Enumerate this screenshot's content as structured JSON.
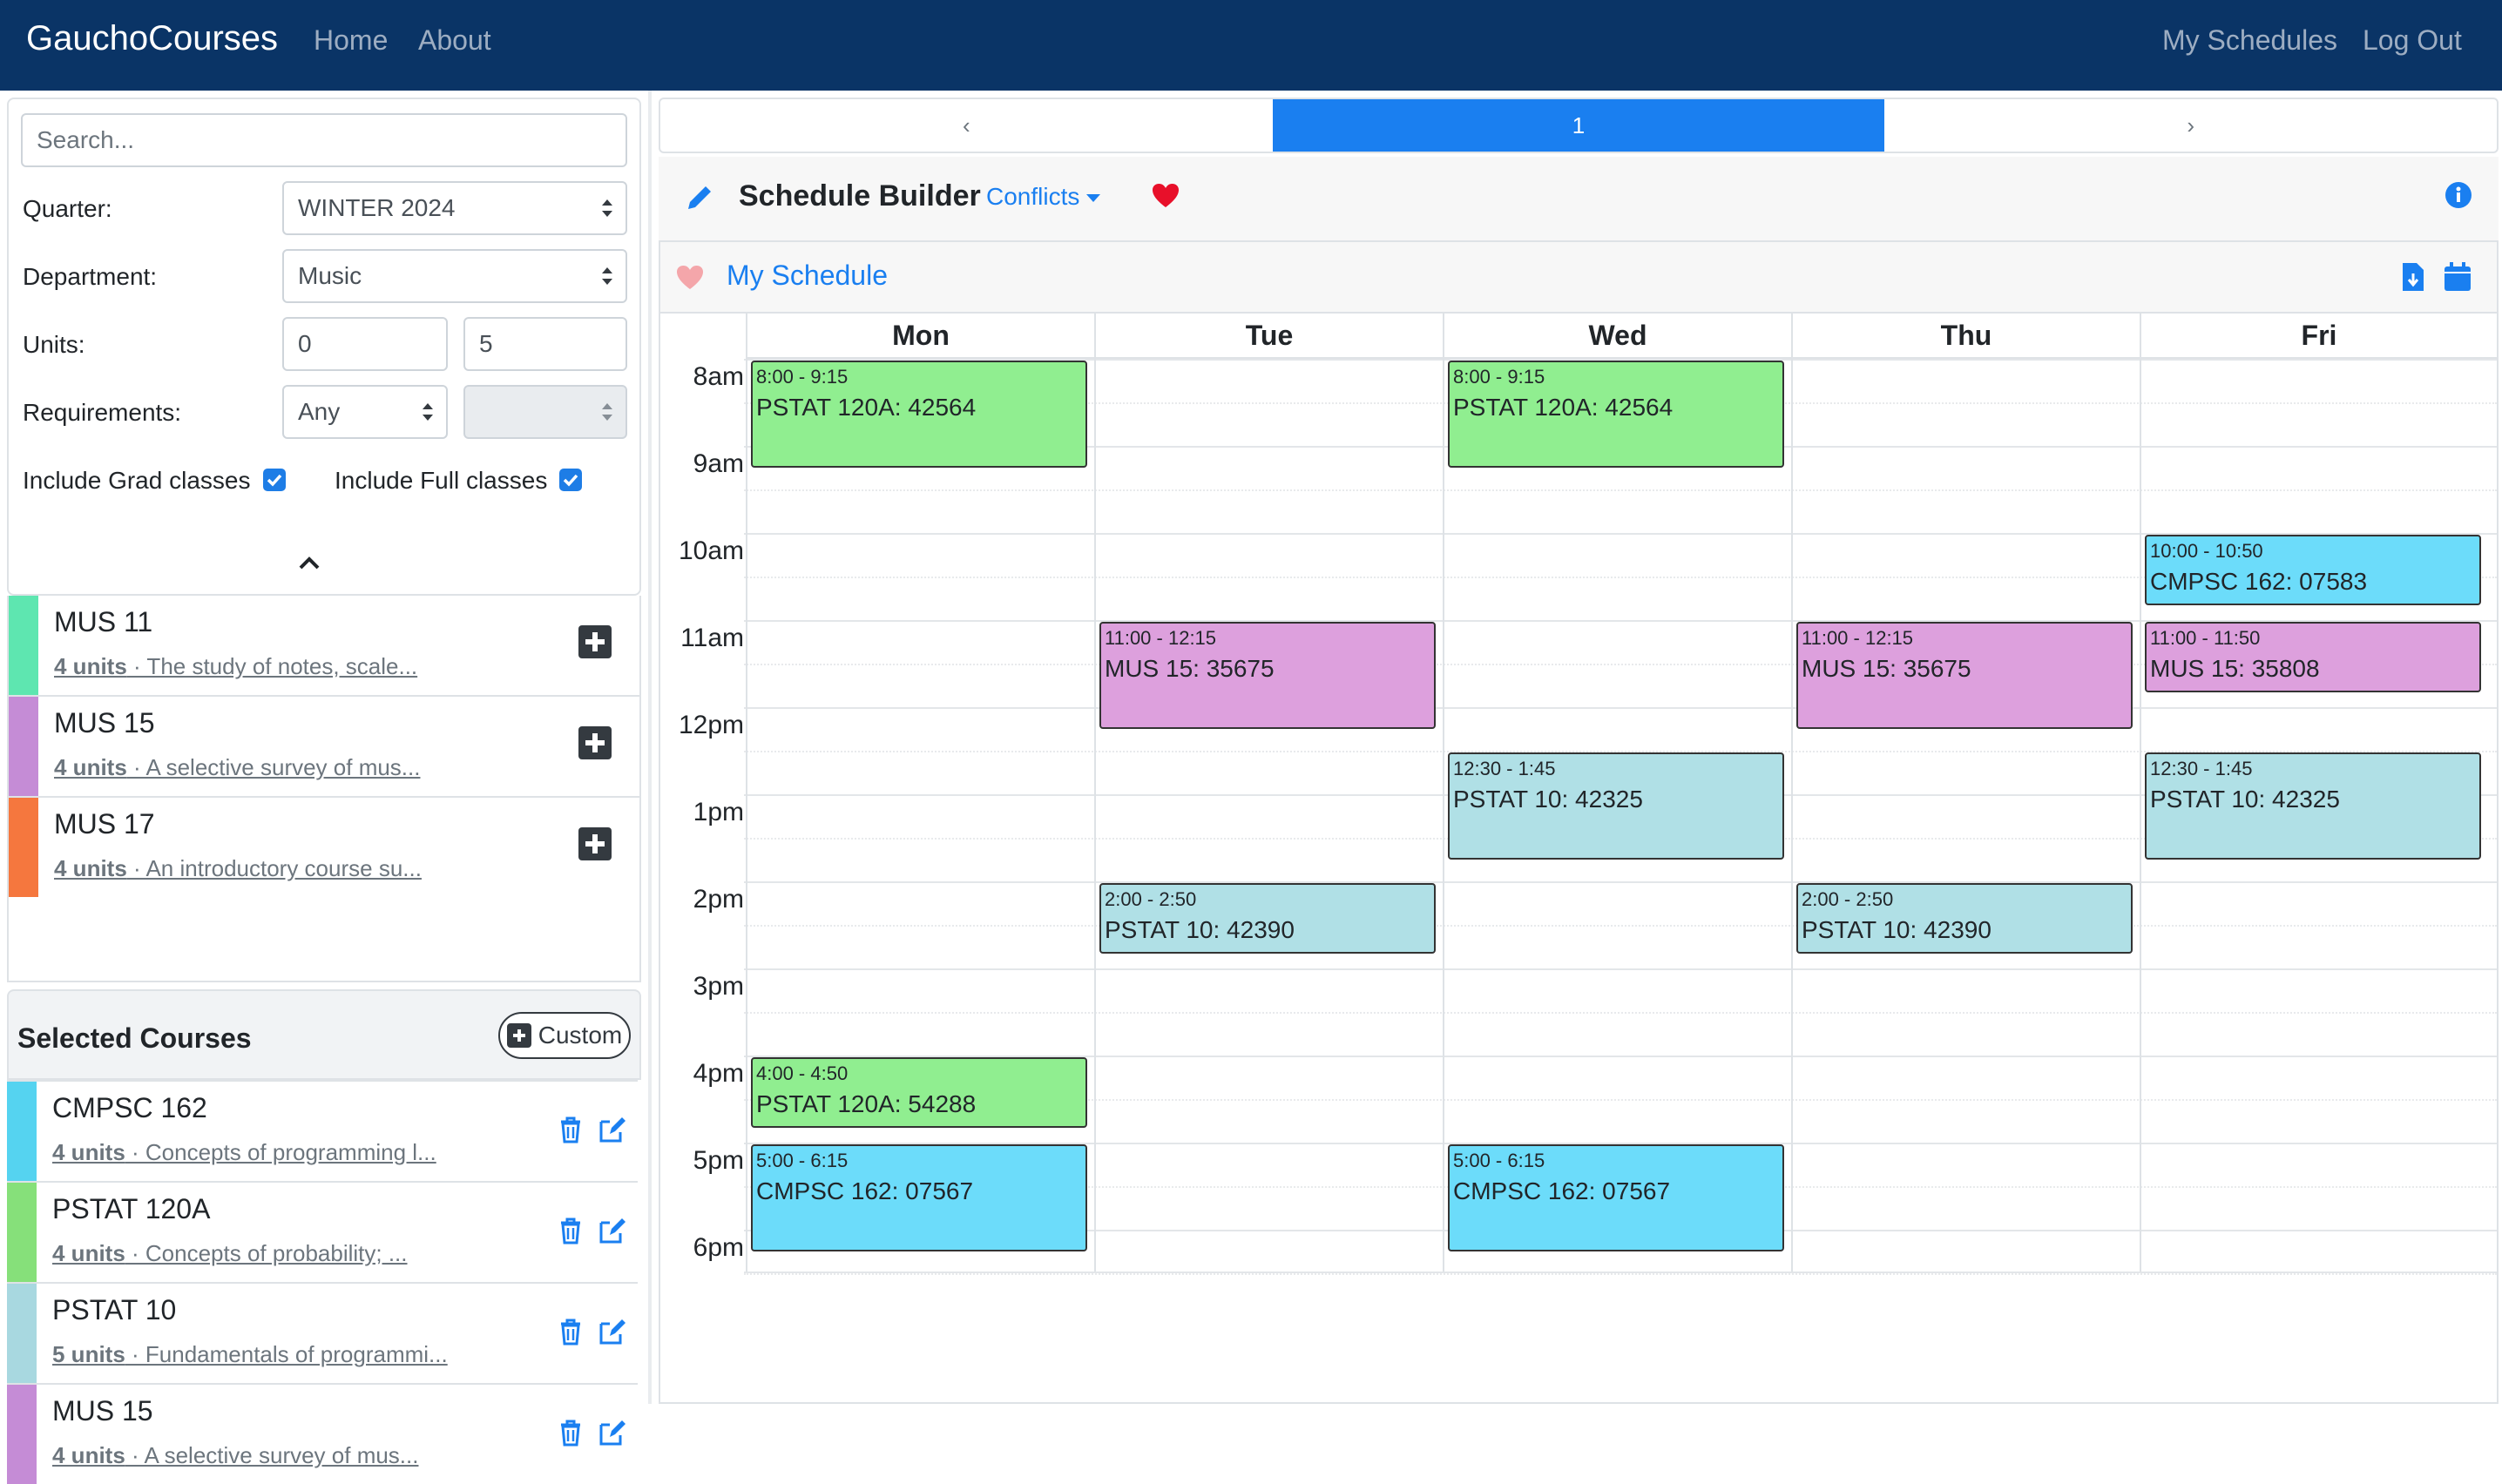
{
  "navbar": {
    "brand": "GauchoCourses",
    "links": [
      "Home",
      "About"
    ],
    "right_links": [
      "My Schedules",
      "Log Out"
    ]
  },
  "filters": {
    "search_placeholder": "Search...",
    "quarter_label": "Quarter:",
    "quarter_value": "WINTER 2024",
    "department_label": "Department:",
    "department_value": "Music",
    "units_label": "Units:",
    "units_min": "0",
    "units_max": "5",
    "requirements_label": "Requirements:",
    "requirements_value": "Any",
    "requirements_sub_value": "",
    "include_grad_label": "Include Grad classes",
    "include_grad_checked": true,
    "include_full_label": "Include Full classes",
    "include_full_checked": true
  },
  "search_results": [
    {
      "name": "MUS 11",
      "units": "4 units",
      "desc": " · The study of notes, scale...",
      "color": "#5ee6b0"
    },
    {
      "name": "MUS 15",
      "units": "4 units",
      "desc": " · A selective survey of mus...",
      "color": "#c58cd6"
    },
    {
      "name": "MUS 17",
      "units": "4 units",
      "desc": " · An introductory course su...",
      "color": "#f5773e"
    }
  ],
  "selected": {
    "title": "Selected Courses",
    "custom_label": "Custom",
    "courses": [
      {
        "name": "CMPSC 162",
        "units": "4 units",
        "desc": " · Concepts of programming l...",
        "color": "#55d3f0"
      },
      {
        "name": "PSTAT 120A",
        "units": "4 units",
        "desc": " · Concepts of probability; ...",
        "color": "#86e07a"
      },
      {
        "name": "PSTAT 10",
        "units": "5 units",
        "desc": " · Fundamentals of programmi...",
        "color": "#a8d8e0"
      },
      {
        "name": "MUS 15",
        "units": "4 units",
        "desc": " · A selective survey of mus...",
        "color": "#c58cd6"
      }
    ]
  },
  "pager": {
    "prev": "‹",
    "current": "1",
    "next": "›"
  },
  "builder": {
    "title": "Schedule Builder",
    "conflicts_label": "Conflicts"
  },
  "schedule": {
    "title": "My Schedule",
    "days": [
      "Mon",
      "Tue",
      "Wed",
      "Thu",
      "Fri"
    ],
    "times": [
      "8am",
      "9am",
      "10am",
      "11am",
      "12pm",
      "1pm",
      "2pm",
      "3pm",
      "4pm",
      "5pm",
      "6pm"
    ],
    "events": [
      {
        "day": 0,
        "start": 8.0,
        "end": 9.25,
        "time": "8:00 - 9:15",
        "label": "PSTAT 120A: 42564",
        "color": "#90ee90"
      },
      {
        "day": 2,
        "start": 8.0,
        "end": 9.25,
        "time": "8:00 - 9:15",
        "label": "PSTAT 120A: 42564",
        "color": "#90ee90"
      },
      {
        "day": 4,
        "start": 10.0,
        "end": 10.8333,
        "time": "10:00 - 10:50",
        "label": "CMPSC 162: 07583",
        "color": "#6cdcfa"
      },
      {
        "day": 1,
        "start": 11.0,
        "end": 12.25,
        "time": "11:00 - 12:15",
        "label": "MUS 15: 35675",
        "color": "#dda0dd"
      },
      {
        "day": 3,
        "start": 11.0,
        "end": 12.25,
        "time": "11:00 - 12:15",
        "label": "MUS 15: 35675",
        "color": "#dda0dd"
      },
      {
        "day": 4,
        "start": 11.0,
        "end": 11.8333,
        "time": "11:00 - 11:50",
        "label": "MUS 15: 35808",
        "color": "#dda0dd"
      },
      {
        "day": 2,
        "start": 12.5,
        "end": 13.75,
        "time": "12:30 - 1:45",
        "label": "PSTAT 10: 42325",
        "color": "#b0e0e6"
      },
      {
        "day": 4,
        "start": 12.5,
        "end": 13.75,
        "time": "12:30 - 1:45",
        "label": "PSTAT 10: 42325",
        "color": "#b0e0e6"
      },
      {
        "day": 1,
        "start": 14.0,
        "end": 14.8333,
        "time": "2:00 - 2:50",
        "label": "PSTAT 10: 42390",
        "color": "#b0e0e6"
      },
      {
        "day": 3,
        "start": 14.0,
        "end": 14.8333,
        "time": "2:00 - 2:50",
        "label": "PSTAT 10: 42390",
        "color": "#b0e0e6"
      },
      {
        "day": 0,
        "start": 16.0,
        "end": 16.8333,
        "time": "4:00 - 4:50",
        "label": "PSTAT 120A: 54288",
        "color": "#90ee90"
      },
      {
        "day": 0,
        "start": 17.0,
        "end": 18.25,
        "time": "5:00 - 6:15",
        "label": "CMPSC 162: 07567",
        "color": "#6cdcfa"
      },
      {
        "day": 2,
        "start": 17.0,
        "end": 18.25,
        "time": "5:00 - 6:15",
        "label": "CMPSC 162: 07567",
        "color": "#6cdcfa"
      }
    ]
  },
  "colors": {
    "navbar": "#0a3466",
    "accent": "#1a7ff0",
    "heart": "#e8102a",
    "heart_light": "#f4a6aa"
  },
  "icons": [
    "pencil-icon",
    "heart-icon",
    "info-icon",
    "download-icon",
    "calendar-icon",
    "plus-square-icon",
    "trash-icon",
    "edit-icon",
    "chevron-up-icon"
  ]
}
